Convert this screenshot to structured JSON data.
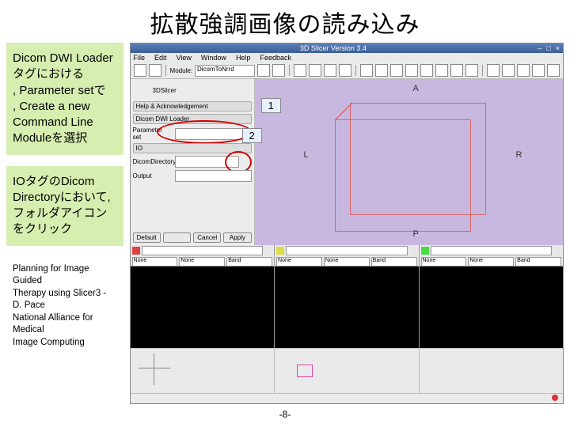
{
  "title": "拡散強調画像の読み込み",
  "callout1": {
    "line1": "Dicom DWI Loader",
    "line2": "タグにおける",
    "line3": ", Parameter setで",
    "line4": ", Create a new",
    "line5": "Command Line",
    "line6": "Moduleを選択"
  },
  "callout2": {
    "line1": "IOタグのDicom",
    "line2": "Directoryにおいて,",
    "line3": "フォルダアイコン",
    "line4": "をクリック"
  },
  "credit": {
    "line1": "Planning for Image Guided",
    "line2": "Therapy using Slicer3 - D. Pace",
    "line3": "National Alliance for Medical",
    "line4": "Image Computing"
  },
  "page_num": "-8-",
  "app": {
    "window_title": "3D Slicer Version 3.4",
    "menu": [
      "File",
      "Edit",
      "View",
      "Window",
      "Help",
      "Feedback"
    ],
    "module_label": "Module:",
    "module_value": "DicomToNrrd",
    "welcome": "3DSlicer",
    "panel": {
      "section1": "Help & Acknowledgement",
      "section2": "Dicom DWI Loader",
      "param_label": "Parameter set",
      "param_value": "",
      "io": "IO",
      "dicom_label": "DicomDirectory",
      "dicom_value": "",
      "output_label": "Output",
      "buttons": [
        "Default",
        "",
        "Cancel",
        "Apply"
      ]
    },
    "axes": {
      "top": "A",
      "left": "L",
      "right": "R",
      "bottom": "P"
    },
    "badges": {
      "one": "1",
      "two": "2"
    },
    "slice_headers": {
      "none": "None",
      "band": "Band"
    }
  }
}
